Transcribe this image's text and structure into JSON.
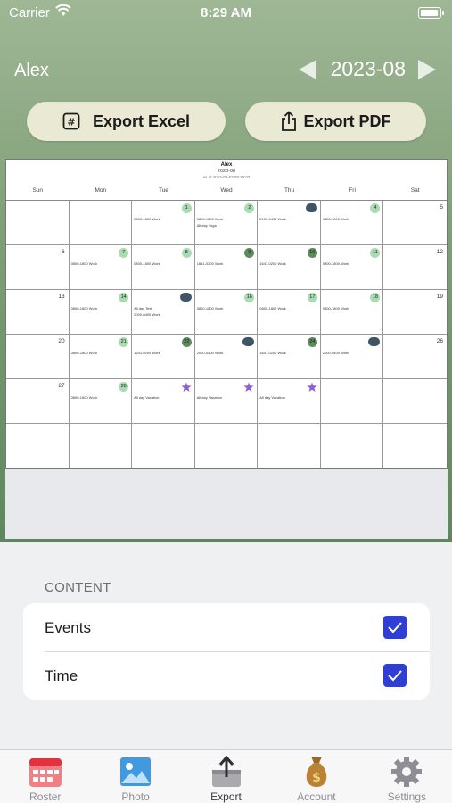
{
  "status_bar": {
    "carrier": "Carrier",
    "time": "8:29 AM"
  },
  "header": {
    "user": "Alex",
    "month": "2023-08"
  },
  "buttons": {
    "export_excel": "Export Excel",
    "export_pdf": "Export PDF"
  },
  "preview": {
    "title": "Alex",
    "month": "2023-08",
    "generated": "as at 2023-09-03 08:29:03",
    "weekdays": [
      "Sun",
      "Mon",
      "Tue",
      "Wed",
      "Thu",
      "Fri",
      "Sat"
    ],
    "cells": [
      {
        "day": "",
        "badge": "",
        "events": []
      },
      {
        "day": "",
        "badge": "",
        "events": []
      },
      {
        "day": "1",
        "badge": "light",
        "events": [
          "0800-1800 Work"
        ]
      },
      {
        "day": "2",
        "badge": "light",
        "events": [
          "0800-1800 Work",
          "All day Yoga"
        ]
      },
      {
        "day": "3",
        "badge": "cloud",
        "events": [
          "2000-0400 Work"
        ]
      },
      {
        "day": "4",
        "badge": "light",
        "events": [
          "0800-1800 Work"
        ]
      },
      {
        "day": "5",
        "badge": "",
        "events": []
      },
      {
        "day": "6",
        "badge": "",
        "events": []
      },
      {
        "day": "7",
        "badge": "light",
        "events": [
          "0800-1800 Work"
        ]
      },
      {
        "day": "8",
        "badge": "light",
        "events": [
          "0800-1800 Work"
        ]
      },
      {
        "day": "9",
        "badge": "dark",
        "events": [
          "1641-0200 Work"
        ]
      },
      {
        "day": "10",
        "badge": "dark",
        "events": [
          "1641-0200 Work"
        ]
      },
      {
        "day": "11",
        "badge": "light",
        "events": [
          "0800-1800 Work"
        ]
      },
      {
        "day": "12",
        "badge": "",
        "events": []
      },
      {
        "day": "13",
        "badge": "",
        "events": []
      },
      {
        "day": "14",
        "badge": "light",
        "events": [
          "0800-1800 Work"
        ]
      },
      {
        "day": "15",
        "badge": "cloud",
        "events": [
          "All day Test",
          "2000-0400 Work"
        ]
      },
      {
        "day": "16",
        "badge": "light",
        "events": [
          "0800-1800 Work"
        ]
      },
      {
        "day": "17",
        "badge": "light",
        "events": [
          "0800-1800 Work"
        ]
      },
      {
        "day": "18",
        "badge": "light",
        "events": [
          "0800-1800 Work"
        ]
      },
      {
        "day": "19",
        "badge": "",
        "events": []
      },
      {
        "day": "20",
        "badge": "",
        "events": []
      },
      {
        "day": "21",
        "badge": "light",
        "events": [
          "0800-1800 Work"
        ]
      },
      {
        "day": "22",
        "badge": "dark",
        "events": [
          "1641-0200 Work"
        ]
      },
      {
        "day": "23",
        "badge": "cloud",
        "events": [
          "2000-0400 Work"
        ]
      },
      {
        "day": "24",
        "badge": "dark",
        "events": [
          "1641-0200 Work"
        ]
      },
      {
        "day": "25",
        "badge": "cloud",
        "events": [
          "2000-0400 Work"
        ]
      },
      {
        "day": "26",
        "badge": "",
        "events": []
      },
      {
        "day": "27",
        "badge": "",
        "events": []
      },
      {
        "day": "28",
        "badge": "light",
        "events": [
          "0800-1800 Work"
        ]
      },
      {
        "day": "29",
        "badge": "star",
        "events": [
          "All day Vacation"
        ]
      },
      {
        "day": "30",
        "badge": "star",
        "events": [
          "All day Vacation"
        ]
      },
      {
        "day": "31",
        "badge": "star",
        "events": [
          "All day Vacation"
        ]
      },
      {
        "day": "",
        "badge": "",
        "events": []
      },
      {
        "day": "",
        "badge": "",
        "events": []
      },
      {
        "day": "",
        "badge": "",
        "events": []
      },
      {
        "day": "",
        "badge": "",
        "events": []
      },
      {
        "day": "",
        "badge": "",
        "events": []
      },
      {
        "day": "",
        "badge": "",
        "events": []
      },
      {
        "day": "",
        "badge": "",
        "events": []
      },
      {
        "day": "",
        "badge": "",
        "events": []
      },
      {
        "day": "",
        "badge": "",
        "events": []
      }
    ]
  },
  "content": {
    "section_title": "CONTENT",
    "options": [
      {
        "label": "Events",
        "checked": true
      },
      {
        "label": "Time",
        "checked": true
      }
    ]
  },
  "tabs": [
    {
      "label": "Roster",
      "icon": "calendar-icon",
      "active": false
    },
    {
      "label": "Photo",
      "icon": "photo-icon",
      "active": false
    },
    {
      "label": "Export",
      "icon": "export-icon",
      "active": true
    },
    {
      "label": "Account",
      "icon": "money-bag-icon",
      "active": false
    },
    {
      "label": "Settings",
      "icon": "gear-icon",
      "active": false
    }
  ],
  "colors": {
    "accent": "#2f3fd3",
    "header_top": "#9fb795",
    "header_bottom": "#5f8660",
    "badge_light": "#a9dcb1",
    "badge_dark": "#5e8a5d"
  }
}
